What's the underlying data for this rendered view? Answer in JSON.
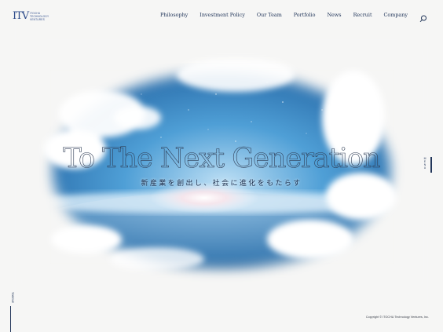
{
  "header": {
    "logo_mark": "ITV",
    "logo_sub": "ITOCHU\nTECHNOLOGY\nVENTURES",
    "nav": [
      "Philosophy",
      "Investment Policy",
      "Our Team",
      "Portfolio",
      "News",
      "Recruit",
      "Company"
    ],
    "search_icon": "search-icon"
  },
  "hero": {
    "headline": "To The Next Generation",
    "tagline": "新産業を創出し、社会に進化をもたらす"
  },
  "side": {
    "menu_label": "MENU",
    "toggle_label": "TOGGLE"
  },
  "footer": {
    "copyright": "Copyright © ITOCHU Technology Ventures, Inc."
  },
  "colors": {
    "brand": "#2c4a8a",
    "text": "#22365a",
    "background": "#f6f6f5",
    "sky": "#3b86c6"
  }
}
